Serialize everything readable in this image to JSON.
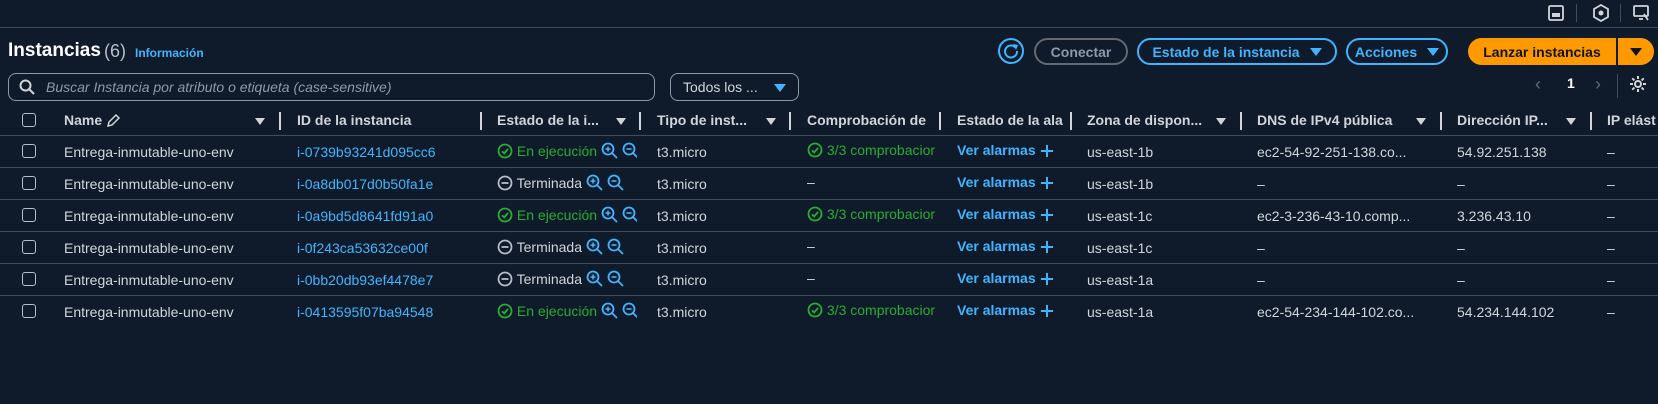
{
  "header": {
    "title": "Instancias",
    "count": "(6)",
    "info": "Información"
  },
  "toolbar": {
    "connect": "Conectar",
    "instance_state": "Estado de la instancia",
    "actions": "Acciones",
    "launch": "Lanzar instancias"
  },
  "filter": {
    "search_placeholder": "Buscar Instancia por atributo o etiqueta (case-sensitive)",
    "state_select": "Todos los ..."
  },
  "pagination": {
    "page": "1"
  },
  "columns": [
    "Name",
    "ID de la instancia",
    "Estado de la i...",
    "Tipo de inst...",
    "Comprobación de",
    "Estado de la ala",
    "Zona de dispon...",
    "DNS de IPv4 pública",
    "Dirección IP...",
    "IP elást"
  ],
  "rows": [
    {
      "name": "Entrega-inmutable-uno-env",
      "id": "i-0739b93241d095cc6",
      "state": "En ejecución",
      "state_kind": "running",
      "type": "t3.micro",
      "check": "3/3 comprobacior",
      "alarm": "Ver alarmas",
      "zone": "us-east-1b",
      "dns": "ec2-54-92-251-138.co...",
      "ip": "54.92.251.138",
      "eip": "–"
    },
    {
      "name": "Entrega-inmutable-uno-env",
      "id": "i-0a8db017d0b50fa1e",
      "state": "Terminada",
      "state_kind": "terminated",
      "type": "t3.micro",
      "check": "–",
      "alarm": "Ver alarmas",
      "zone": "us-east-1b",
      "dns": "–",
      "ip": "–",
      "eip": "–"
    },
    {
      "name": "Entrega-inmutable-uno-env",
      "id": "i-0a9bd5d8641fd91a0",
      "state": "En ejecución",
      "state_kind": "running",
      "type": "t3.micro",
      "check": "3/3 comprobacior",
      "alarm": "Ver alarmas",
      "zone": "us-east-1c",
      "dns": "ec2-3-236-43-10.comp...",
      "ip": "3.236.43.10",
      "eip": "–"
    },
    {
      "name": "Entrega-inmutable-uno-env",
      "id": "i-0f243ca53632ce00f",
      "state": "Terminada",
      "state_kind": "terminated",
      "type": "t3.micro",
      "check": "–",
      "alarm": "Ver alarmas",
      "zone": "us-east-1c",
      "dns": "–",
      "ip": "–",
      "eip": "–"
    },
    {
      "name": "Entrega-inmutable-uno-env",
      "id": "i-0bb20db93ef4478e7",
      "state": "Terminada",
      "state_kind": "terminated",
      "type": "t3.micro",
      "check": "–",
      "alarm": "Ver alarmas",
      "zone": "us-east-1a",
      "dns": "–",
      "ip": "–",
      "eip": "–"
    },
    {
      "name": "Entrega-inmutable-uno-env",
      "id": "i-0413595f07ba94548",
      "state": "En ejecución",
      "state_kind": "running",
      "type": "t3.micro",
      "check": "3/3 comprobacior",
      "alarm": "Ver alarmas",
      "zone": "us-east-1a",
      "dns": "ec2-54-234-144-102.co...",
      "ip": "54.234.144.102",
      "eip": "–"
    }
  ],
  "colors": {
    "background": "#0f1b2a",
    "accent": "#42b4ff",
    "launch": "#ff9900",
    "success": "#29ad32",
    "border": "#414d5c"
  }
}
